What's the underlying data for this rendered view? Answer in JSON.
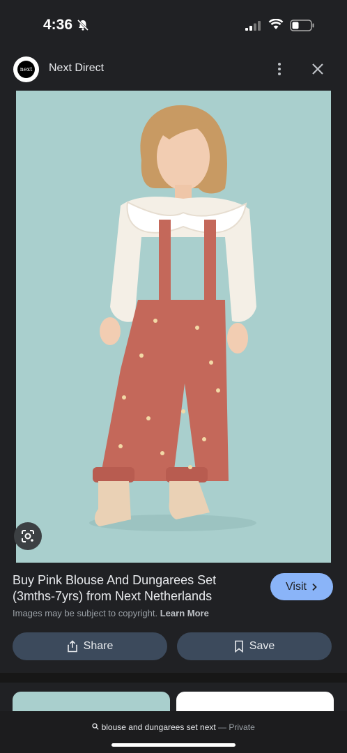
{
  "status_bar": {
    "time": "4:36"
  },
  "header": {
    "logo_text": "next",
    "site_name": "Next Direct"
  },
  "image": {
    "description_icon": "google-lens-icon"
  },
  "result": {
    "title": "Buy Pink Blouse And Dungarees Set (3mths-7yrs) from Next Netherlands",
    "copyright_text": "Images may be subject to copyright.",
    "learn_more": "Learn More",
    "visit_label": "Visit",
    "share_label": "Share",
    "save_label": "Save"
  },
  "url_bar": {
    "query": "blouse and dungarees set next",
    "separator": "—",
    "mode": "Private"
  },
  "colors": {
    "background": "#202124",
    "accent": "#8ab4f8",
    "button": "#3c4a5c",
    "image_bg": "#a9cfcd"
  }
}
